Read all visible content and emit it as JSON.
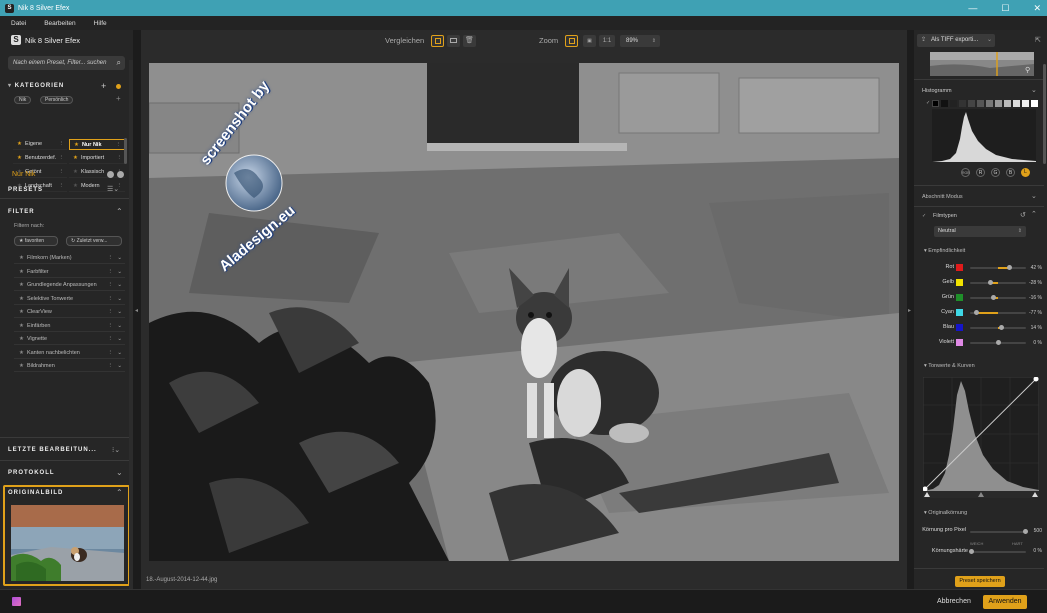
{
  "window": {
    "title": "Nik 8 Silver Efex",
    "controls": [
      "—",
      "☐",
      "✕"
    ]
  },
  "menu": [
    "Datei",
    "Bearbeiten",
    "Hilfe"
  ],
  "left": {
    "app_name": "Nik 8 Silver Efex",
    "search_placeholder": "Nach einem Preset, Filter... suchen",
    "categories_title": "KATEGORIEN",
    "cat_pills": [
      "Nik",
      "Persönlich"
    ],
    "categories": [
      {
        "label": "Eigene",
        "star": true
      },
      {
        "label": "Nur Nik",
        "star": true,
        "selected": true
      },
      {
        "label": "Benutzerdef.",
        "star": true
      },
      {
        "label": "Importiert",
        "star": true
      },
      {
        "label": "Getönt",
        "star": false
      },
      {
        "label": "Klassisch",
        "star": false
      },
      {
        "label": "Landschaft",
        "star": false
      },
      {
        "label": "Modern",
        "star": false
      }
    ],
    "active_category": "Nur Nik",
    "presets_title": "PRESETS",
    "filter_title": "FILTER",
    "filter_by": "Filtern nach:",
    "filter_pills": [
      "★ favoriten",
      "↻ Zuletzt verw..."
    ],
    "filters": [
      "Filmkorn (Marken)",
      "Farbfilter",
      "Grundlegende Anpassungen",
      "Selektive Tonwerte",
      "ClearView",
      "Einfärben",
      "Vignette",
      "Kanten nachbelichten",
      "Bildrahmen"
    ],
    "recent_title": "LETZTE BEARBEITUN...",
    "protocol_title": "PROTOKOLL",
    "original_title": "ORIGINALBILD"
  },
  "toolbar": {
    "compare_label": "Vergleichen",
    "zoom_label": "Zoom",
    "zoom_value": "89%",
    "zoom_1to1": "1:1"
  },
  "image": {
    "filename": "18.-August-2014-12-44.jpg",
    "watermark_line1": "screenshot by",
    "watermark_line2": "Aladesign.eu"
  },
  "right": {
    "export_label": "Als TIFF exporti...",
    "histogram_title": "Histogramm",
    "channel_buttons": [
      "RGB",
      "R",
      "G",
      "B",
      "L"
    ],
    "mode_section": "Abschnitt Modus",
    "filmtypes_label": "Filmtypen",
    "filmtype_value": "Neutral",
    "sensitivity_label": "Empfindlichkeit",
    "sensitivity": [
      {
        "name": "Rot",
        "value": "42 %",
        "level": 0.42,
        "color": "#e01b1b"
      },
      {
        "name": "Gelb",
        "value": "-28 %",
        "level": -0.28,
        "color": "#f2e200"
      },
      {
        "name": "Grün",
        "value": "-16 %",
        "level": -0.16,
        "color": "#1f8f2a"
      },
      {
        "name": "Cyan",
        "value": "-77 %",
        "level": -0.77,
        "color": "#3fd8e6"
      },
      {
        "name": "Blau",
        "value": "14 %",
        "level": 0.14,
        "color": "#1515c9"
      },
      {
        "name": "Violett",
        "value": "0 %",
        "level": 0,
        "color": "#e08ae6"
      }
    ],
    "curves_label": "Tonwerte & Kurven",
    "grain_label": "Originalkörnung",
    "grain_per_pixel_label": "Körnung pro Pixel",
    "grain_per_pixel_value": "500",
    "grain_hardness_label": "Körnungshärte",
    "grain_soft": "WEICH",
    "grain_hard": "HART",
    "grain_hardness_value": "0 %",
    "save_preset": "Preset speichern"
  },
  "bottom": {
    "cancel": "Abbrechen",
    "apply": "Anwenden"
  },
  "colors": {
    "accent": "#e0a11a",
    "titlebar": "#3fa1b4"
  }
}
